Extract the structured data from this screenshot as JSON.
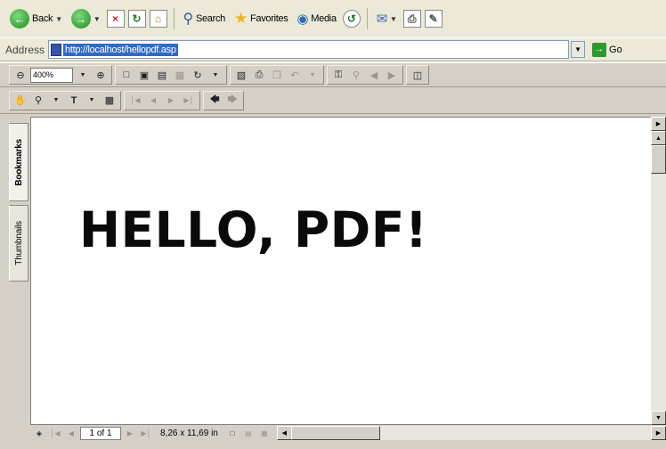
{
  "ie_toolbar": {
    "back_label": "Back",
    "search_label": "Search",
    "favorites_label": "Favorites",
    "media_label": "Media"
  },
  "address_bar": {
    "label": "Address",
    "url": "http://localhost/hellopdf.asp",
    "go_label": "Go"
  },
  "pdf_toolbar": {
    "zoom_value": "400%"
  },
  "side_panel": {
    "tabs": [
      "Bookmarks",
      "Thumbnails"
    ]
  },
  "document": {
    "text": "HELLO, PDF!"
  },
  "status_bar": {
    "page_indicator": "1 of 1",
    "page_size": "8,26 x 11,69 in"
  },
  "colors": {
    "chrome": "#ece9d8",
    "acrobat_chrome": "#d4d0c8",
    "url_highlight": "#316ac5"
  }
}
